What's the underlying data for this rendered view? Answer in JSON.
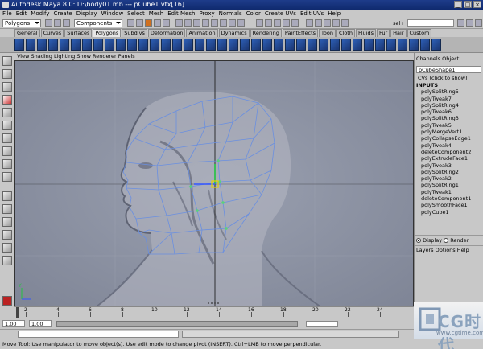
{
  "window": {
    "title": "Autodesk Maya 8.0: D:\\body01.mb  ---  pCube1.vtx[16]...",
    "min": "_",
    "max": "□",
    "close": "×"
  },
  "menubar": [
    "File",
    "Edit",
    "Modify",
    "Create",
    "Display",
    "Window",
    "Select",
    "Mesh",
    "Edit Mesh",
    "Proxy",
    "Normals",
    "Color",
    "Create UVs",
    "Edit UVs",
    "Help"
  ],
  "status_line": {
    "mode": "Polygons",
    "mask": "Components",
    "sel_label": "sel+"
  },
  "shelf_tabs": [
    "General",
    "Curves",
    "Surfaces",
    "Polygons",
    "Subdivs",
    "Deformation",
    "Animation",
    "Dynamics",
    "Rendering",
    "PaintEffects",
    "Toon",
    "Cloth",
    "Fluids",
    "Fur",
    "Hair",
    "Custom"
  ],
  "active_shelf": "Polygons",
  "panel_menu": [
    "View",
    "Shading",
    "Lighting",
    "Show",
    "Renderer",
    "Panels"
  ],
  "channel_box": {
    "header": [
      "Channels",
      "Object"
    ],
    "object": "pCubeShape1",
    "cvs": "CVs (click to show)",
    "inputs_header": "INPUTS",
    "inputs": [
      "polySplitRing5",
      "polyTweak7",
      "polySplitRing4",
      "polyTweak6",
      "polySplitRing3",
      "polyTweak5",
      "polyMergeVert1",
      "polyCollapseEdge1",
      "polyTweak4",
      "deleteComponent2",
      "polyExtrudeFace1",
      "polyTweak3",
      "polySplitRing2",
      "polyTweak2",
      "polySplitRing1",
      "polyTweak1",
      "deleteComponent1",
      "polySmoothFace1",
      "polyCube1"
    ],
    "display_label": "Display",
    "render_label": "Render",
    "layer_menu": [
      "Layers",
      "Options",
      "Help"
    ]
  },
  "timeline": {
    "ticks": [
      "2",
      "4",
      "6",
      "8",
      "10",
      "12",
      "14",
      "16",
      "18",
      "20",
      "22",
      "24"
    ]
  },
  "range": {
    "start": "1.00",
    "current": "1.00"
  },
  "help_line": "Move Tool: Use manipulator to move object(s). Use edit mode to change pivot (INSERT). Ctrl+LMB to move perpendicular.",
  "watermark": {
    "brand": "CG时代",
    "url": "www.cgtime.com.cn"
  }
}
